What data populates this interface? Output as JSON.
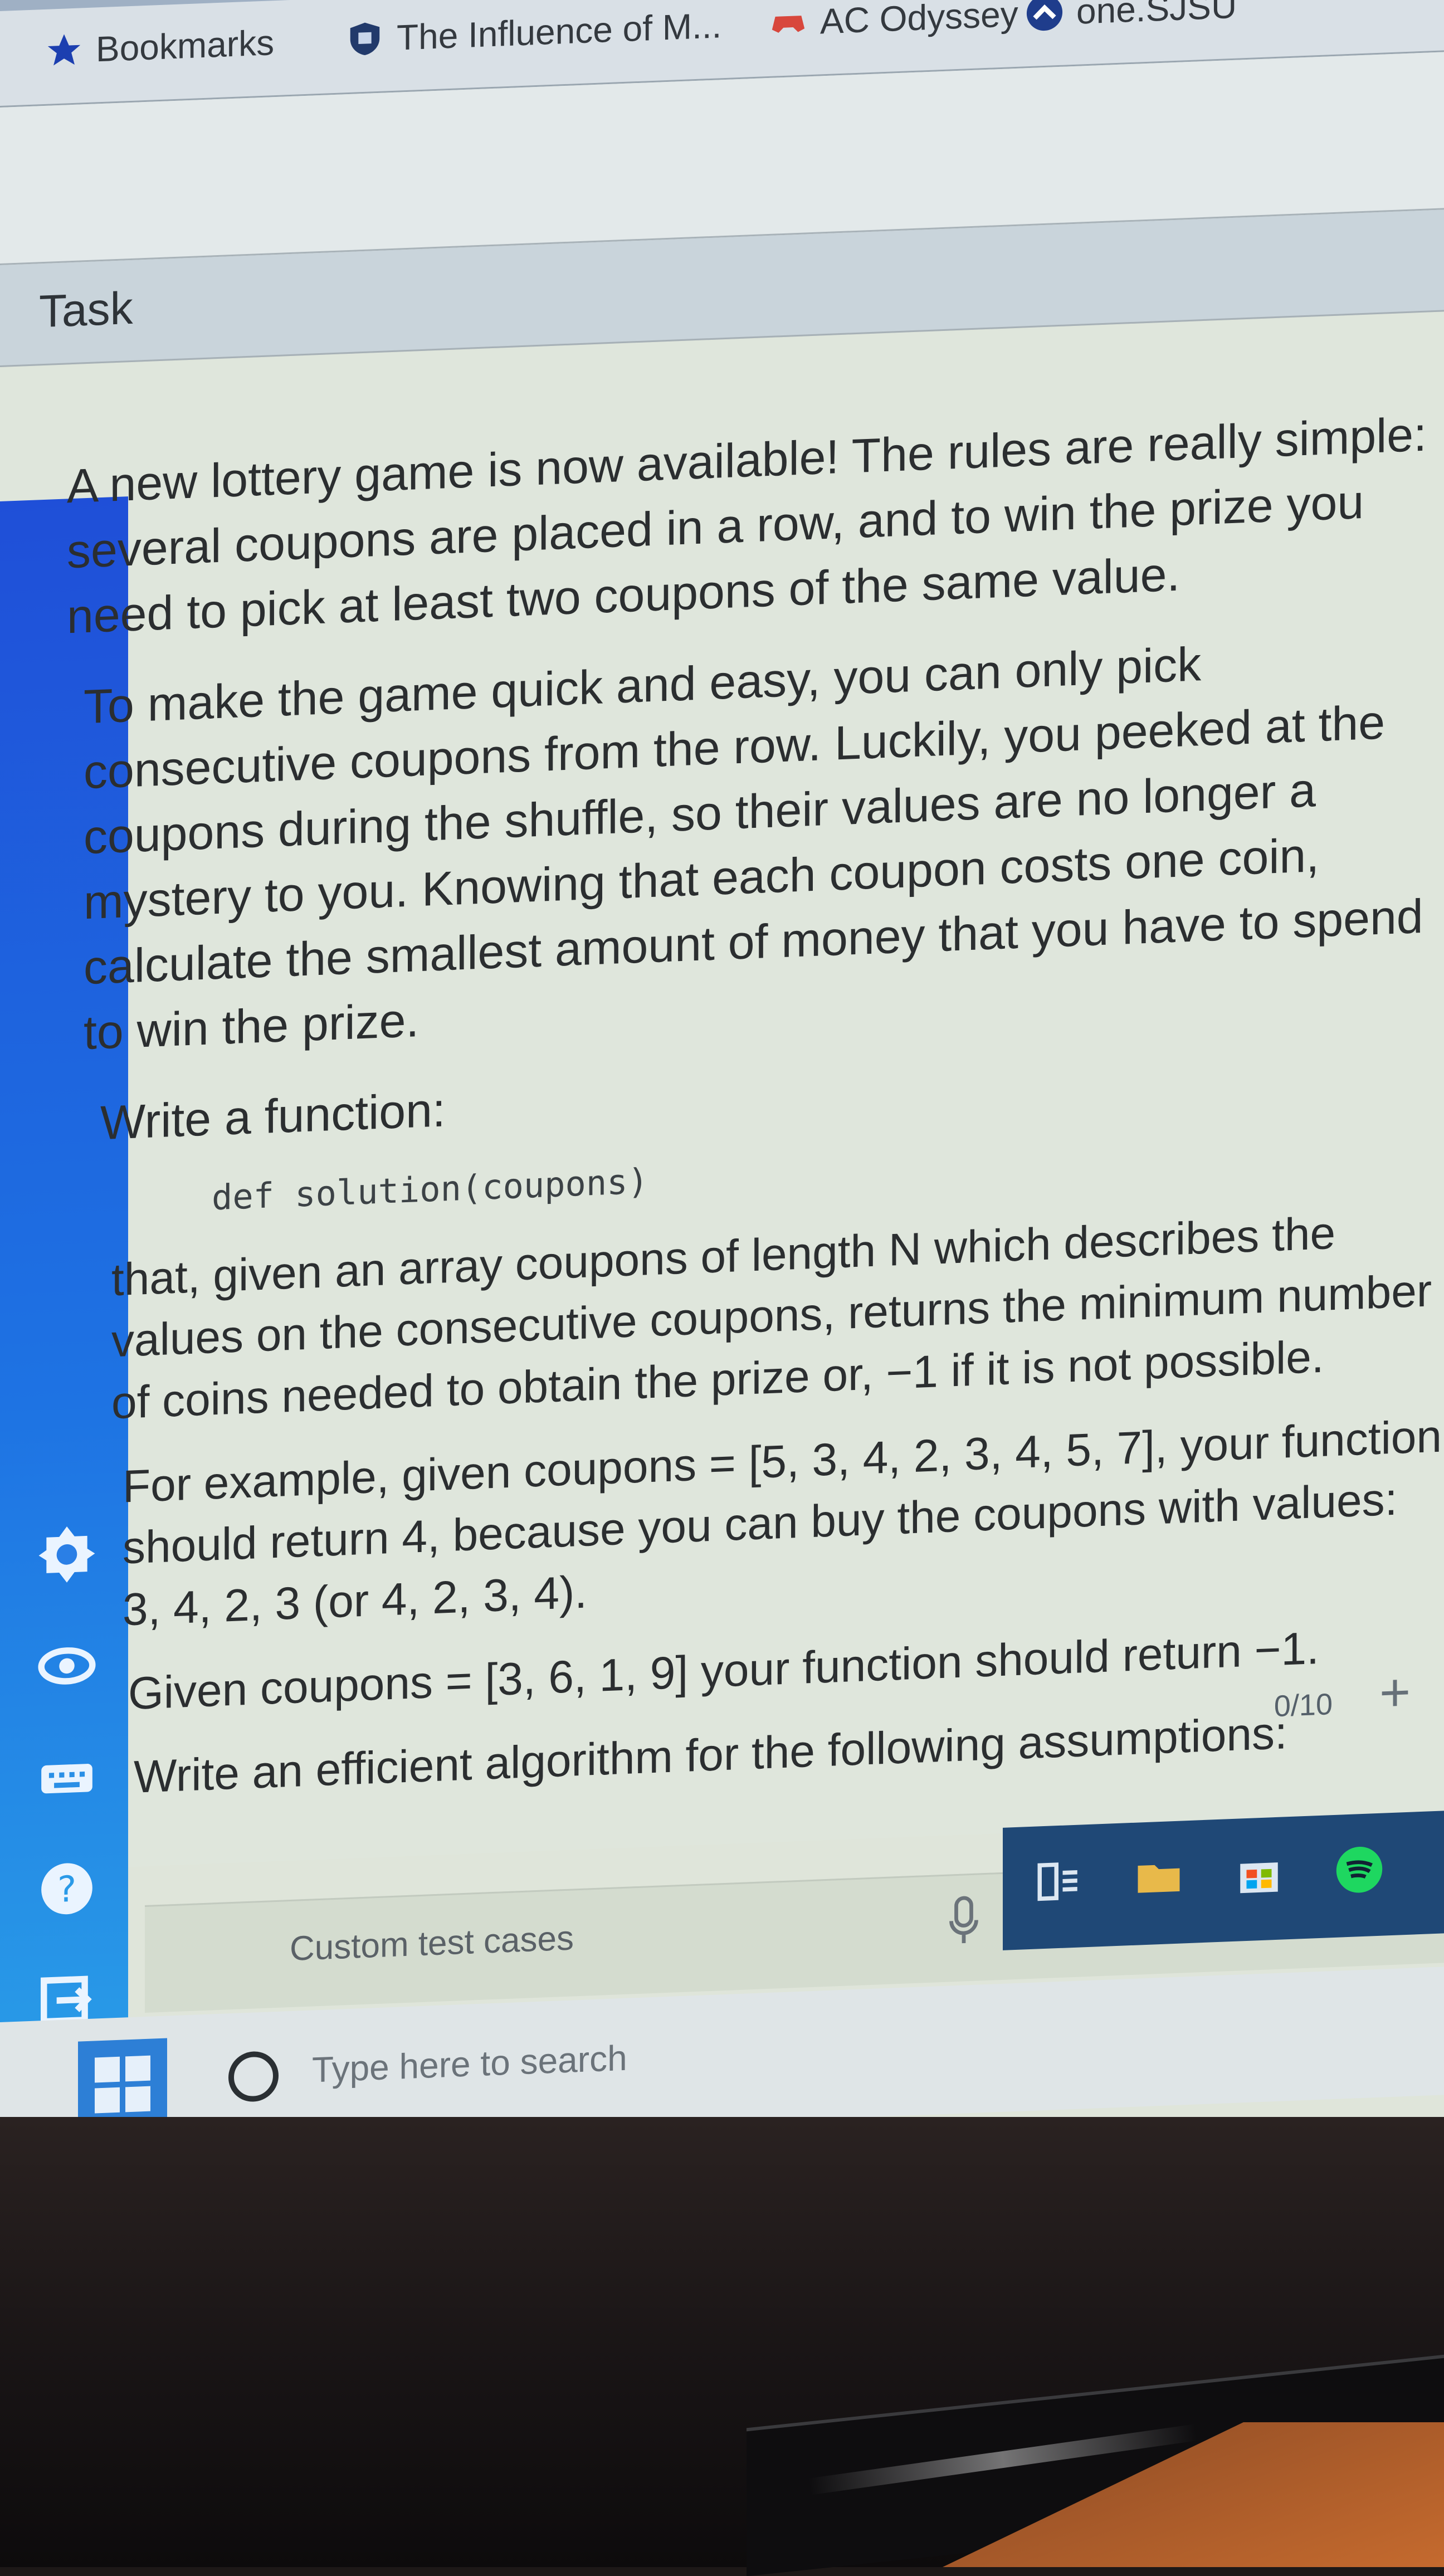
{
  "bookmarks_bar": {
    "items": [
      {
        "label": "Bookmarks",
        "icon": "star-icon"
      },
      {
        "label": "The Influence of M...",
        "icon": "shield-icon"
      },
      {
        "label": "AC Odyssey",
        "icon": "gamepad-icon"
      },
      {
        "label": "one.SJSU",
        "icon": "chevron-up-icon"
      }
    ]
  },
  "task": {
    "title": "Task",
    "paragraphs": [
      "A new lottery game is now available! The rules are really simple: several coupons are placed in a row, and to win the prize you need to pick at least two coupons of the same value.",
      "To make the game quick and easy, you can only pick consecutive coupons from the row. Luckily, you peeked at the coupons during the shuffle, so their values are no longer a mystery to you. Knowing that each coupon costs one coin, calculate the smallest amount of money that you have to spend to win the prize.",
      "Write a function:",
      "that, given an array coupons of length N which describes the values on the consecutive coupons, returns the minimum number of coins needed to obtain the prize or, −1 if it is not possible.",
      "For example, given coupons = [5, 3, 4, 2, 3, 4, 5, 7], your function should return 4, because you can buy the coupons with values: 3, 4, 2, 3 (or 4, 2, 3, 4).",
      "Given coupons = [3, 6, 1, 9] your function should return −1.",
      "Write an efficient algorithm for the following assumptions:"
    ],
    "code": "def solution(coupons)",
    "counter": "0/10",
    "plus": "+"
  },
  "custom_tests": {
    "label": "Custom test cases"
  },
  "taskbar": {
    "search_placeholder": "Type here to search"
  },
  "sidebar": {
    "icons": [
      "brightness-icon",
      "eye-icon",
      "keyboard-icon",
      "help-icon",
      "exit-icon"
    ]
  }
}
